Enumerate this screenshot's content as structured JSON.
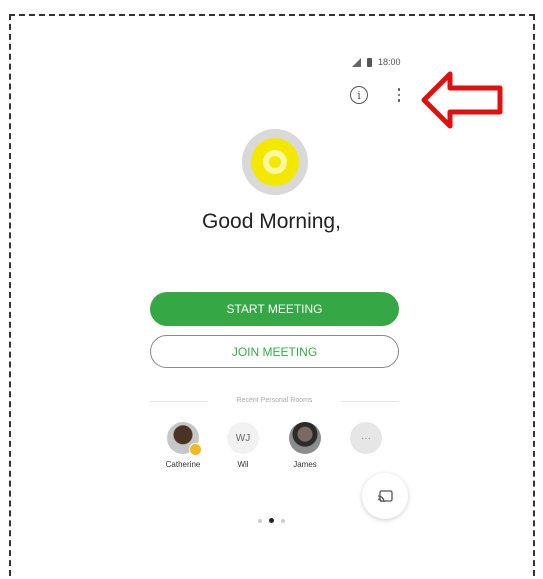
{
  "status_bar": {
    "time": "18:00"
  },
  "greeting": "Good Morning,",
  "actions": {
    "start_label": "START MEETING",
    "join_label": "JOIN MEETING"
  },
  "recent": {
    "label": "Recent Personal Rooms",
    "rooms": [
      {
        "name": "Catherine"
      },
      {
        "name": "Wil",
        "initials": "WJ"
      },
      {
        "name": "James"
      },
      {
        "name": "",
        "initials": "···"
      }
    ]
  },
  "pager": {
    "pages": 3,
    "current": 2
  },
  "colors": {
    "accent_green": "#35a845",
    "highlight_yellow": "#f5e800",
    "annotation_red": "#e01010"
  }
}
